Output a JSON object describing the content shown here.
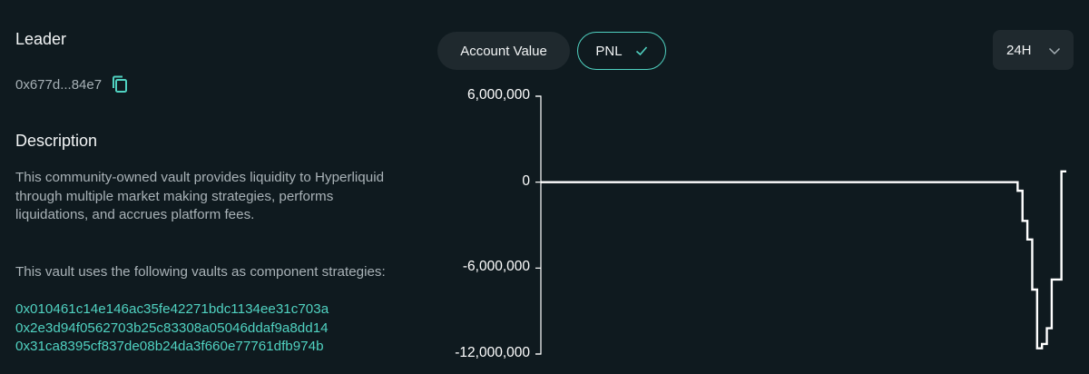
{
  "leader": {
    "title": "Leader",
    "address": "0x677d...84e7"
  },
  "description": {
    "title": "Description",
    "paragraph1": "This community-owned vault provides liquidity to Hyperliquid through multiple market making strategies, performs liquidations, and accrues platform fees.",
    "paragraph2": "This vault uses the following vaults as component strategies:",
    "vaults": [
      "0x010461c14e146ac35fe42271bdc1134ee31c703a",
      "0x2e3d94f0562703b25c83308a05046ddaf9a8dd14",
      "0x31ca8395cf837de08b24da3f660e77761dfb974b"
    ]
  },
  "chart_controls": {
    "account_value_label": "Account Value",
    "pnl_label": "PNL",
    "range_label": "24H",
    "active_tab": "PNL"
  },
  "colors": {
    "background": "#0f1a1f",
    "accent": "#50d2c1",
    "line": "#ffffff"
  },
  "chart_data": {
    "type": "line",
    "title": "",
    "xlabel": "",
    "ylabel": "",
    "yticks": [
      "6,000,000",
      "0",
      "-6,000,000",
      "-12,000,000"
    ],
    "ylim": [
      -12000000,
      6000000
    ],
    "x": [
      0,
      1,
      2,
      3,
      4,
      5,
      6,
      7,
      8,
      9,
      10,
      11,
      12,
      13,
      14,
      15,
      16,
      17,
      18,
      19,
      20,
      21,
      22,
      23,
      24,
      25
    ],
    "y": [
      0,
      0,
      0,
      0,
      0,
      0,
      0,
      0,
      0,
      0,
      0,
      0,
      0,
      0,
      0,
      -600000,
      -2700000,
      -4000000,
      -7500000,
      -11600000,
      -11300000,
      -10200000,
      -6800000,
      -6800000,
      750000,
      750000
    ],
    "step": true,
    "grid": false
  }
}
